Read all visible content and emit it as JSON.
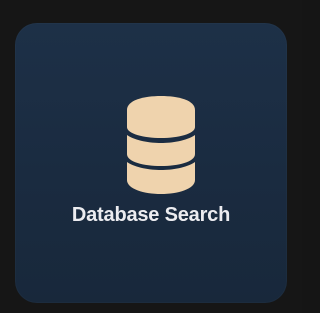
{
  "tile": {
    "label": "Database Search",
    "icon": "database-icon",
    "colors": {
      "background": "#1d3047",
      "icon": "#efd3ad",
      "label": "#ececf0",
      "page": "#161616"
    }
  }
}
